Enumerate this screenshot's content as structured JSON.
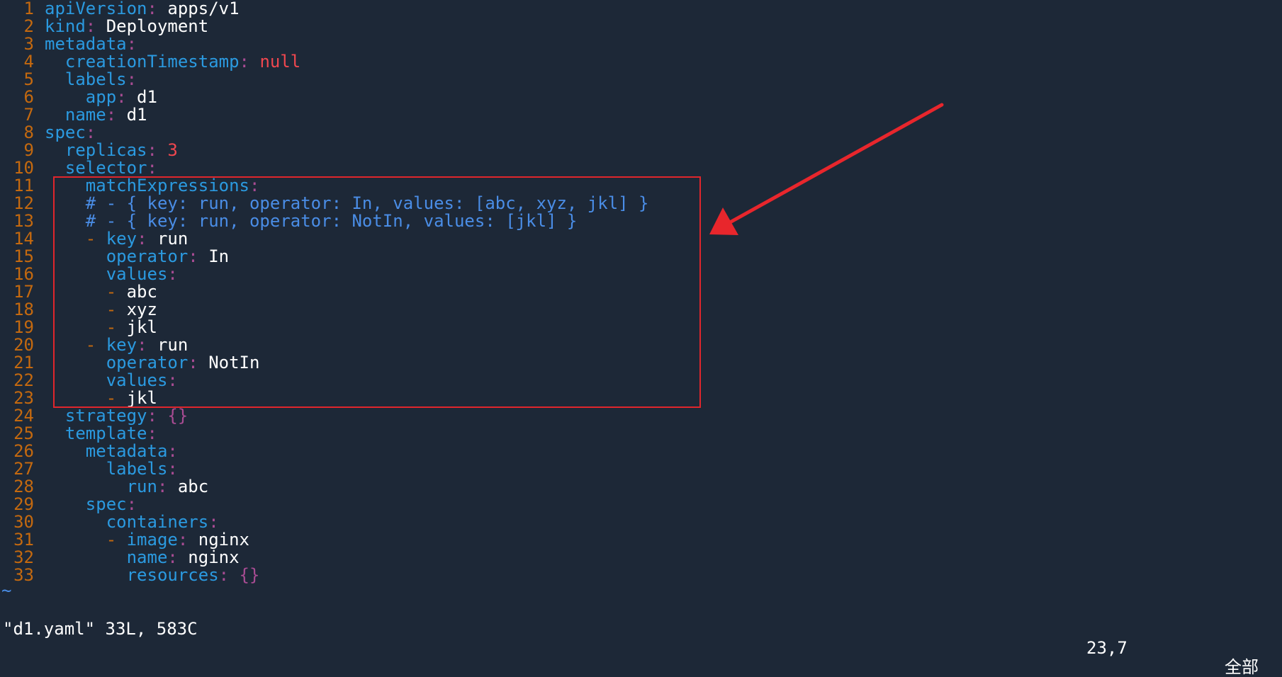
{
  "editor": {
    "lines": [
      [
        [
          "key",
          "apiVersion"
        ],
        [
          "colon",
          ":"
        ],
        [
          "val",
          " apps/v1"
        ]
      ],
      [
        [
          "key",
          "kind"
        ],
        [
          "colon",
          ":"
        ],
        [
          "val",
          " Deployment"
        ]
      ],
      [
        [
          "key",
          "metadata"
        ],
        [
          "colon",
          ":"
        ]
      ],
      [
        [
          "plain",
          "  "
        ],
        [
          "key",
          "creationTimestamp"
        ],
        [
          "colon",
          ":"
        ],
        [
          "null",
          " null"
        ]
      ],
      [
        [
          "plain",
          "  "
        ],
        [
          "key",
          "labels"
        ],
        [
          "colon",
          ":"
        ]
      ],
      [
        [
          "plain",
          "    "
        ],
        [
          "key",
          "app"
        ],
        [
          "colon",
          ":"
        ],
        [
          "val",
          " d1"
        ]
      ],
      [
        [
          "plain",
          "  "
        ],
        [
          "key",
          "name"
        ],
        [
          "colon",
          ":"
        ],
        [
          "val",
          " d1"
        ]
      ],
      [
        [
          "key",
          "spec"
        ],
        [
          "colon",
          ":"
        ]
      ],
      [
        [
          "plain",
          "  "
        ],
        [
          "key",
          "replicas"
        ],
        [
          "colon",
          ":"
        ],
        [
          "num",
          " 3"
        ]
      ],
      [
        [
          "plain",
          "  "
        ],
        [
          "key",
          "selector"
        ],
        [
          "colon",
          ":"
        ]
      ],
      [
        [
          "plain",
          "    "
        ],
        [
          "key",
          "matchExpressions"
        ],
        [
          "colon",
          ":"
        ]
      ],
      [
        [
          "plain",
          "    "
        ],
        [
          "comment",
          "# - { key: run, operator: In, values: [abc, xyz, jkl] }"
        ]
      ],
      [
        [
          "plain",
          "    "
        ],
        [
          "comment",
          "# - { key: run, operator: NotIn, values: [jkl] }"
        ]
      ],
      [
        [
          "plain",
          "    "
        ],
        [
          "dash",
          "- "
        ],
        [
          "key",
          "key"
        ],
        [
          "colon",
          ":"
        ],
        [
          "val",
          " run"
        ]
      ],
      [
        [
          "plain",
          "      "
        ],
        [
          "key",
          "operator"
        ],
        [
          "colon",
          ":"
        ],
        [
          "val",
          " In"
        ]
      ],
      [
        [
          "plain",
          "      "
        ],
        [
          "key",
          "values"
        ],
        [
          "colon",
          ":"
        ]
      ],
      [
        [
          "plain",
          "      "
        ],
        [
          "dash",
          "- "
        ],
        [
          "val",
          "abc"
        ]
      ],
      [
        [
          "plain",
          "      "
        ],
        [
          "dash",
          "- "
        ],
        [
          "val",
          "xyz"
        ]
      ],
      [
        [
          "plain",
          "      "
        ],
        [
          "dash",
          "- "
        ],
        [
          "val",
          "jkl"
        ]
      ],
      [
        [
          "plain",
          "    "
        ],
        [
          "dash",
          "- "
        ],
        [
          "key",
          "key"
        ],
        [
          "colon",
          ":"
        ],
        [
          "val",
          " run"
        ]
      ],
      [
        [
          "plain",
          "      "
        ],
        [
          "key",
          "operator"
        ],
        [
          "colon",
          ":"
        ],
        [
          "val",
          " NotIn"
        ]
      ],
      [
        [
          "plain",
          "      "
        ],
        [
          "key",
          "values"
        ],
        [
          "colon",
          ":"
        ]
      ],
      [
        [
          "plain",
          "      "
        ],
        [
          "dash",
          "- "
        ],
        [
          "val",
          "jkl"
        ]
      ],
      [
        [
          "plain",
          "  "
        ],
        [
          "key",
          "strategy"
        ],
        [
          "colon",
          ":"
        ],
        [
          "brace",
          " {}"
        ]
      ],
      [
        [
          "plain",
          "  "
        ],
        [
          "key",
          "template"
        ],
        [
          "colon",
          ":"
        ]
      ],
      [
        [
          "plain",
          "    "
        ],
        [
          "key",
          "metadata"
        ],
        [
          "colon",
          ":"
        ]
      ],
      [
        [
          "plain",
          "      "
        ],
        [
          "key",
          "labels"
        ],
        [
          "colon",
          ":"
        ]
      ],
      [
        [
          "plain",
          "        "
        ],
        [
          "key",
          "run"
        ],
        [
          "colon",
          ":"
        ],
        [
          "val",
          " abc"
        ]
      ],
      [
        [
          "plain",
          "    "
        ],
        [
          "key",
          "spec"
        ],
        [
          "colon",
          ":"
        ]
      ],
      [
        [
          "plain",
          "      "
        ],
        [
          "key",
          "containers"
        ],
        [
          "colon",
          ":"
        ]
      ],
      [
        [
          "plain",
          "      "
        ],
        [
          "dash",
          "- "
        ],
        [
          "key",
          "image"
        ],
        [
          "colon",
          ":"
        ],
        [
          "val",
          " nginx"
        ]
      ],
      [
        [
          "plain",
          "        "
        ],
        [
          "key",
          "name"
        ],
        [
          "colon",
          ":"
        ],
        [
          "val",
          " nginx"
        ]
      ],
      [
        [
          "plain",
          "        "
        ],
        [
          "key",
          "resources"
        ],
        [
          "colon",
          ":"
        ],
        [
          "brace",
          " {}"
        ]
      ]
    ],
    "empty_line_marker": "~"
  },
  "status_bar": {
    "file_info": "\"d1.yaml\" 33L, 583C",
    "cursor_position": "23,7",
    "scroll_position": "全部"
  },
  "annotation": {
    "highlight_color": "#e0262c",
    "arrow_color": "#e8262c"
  }
}
